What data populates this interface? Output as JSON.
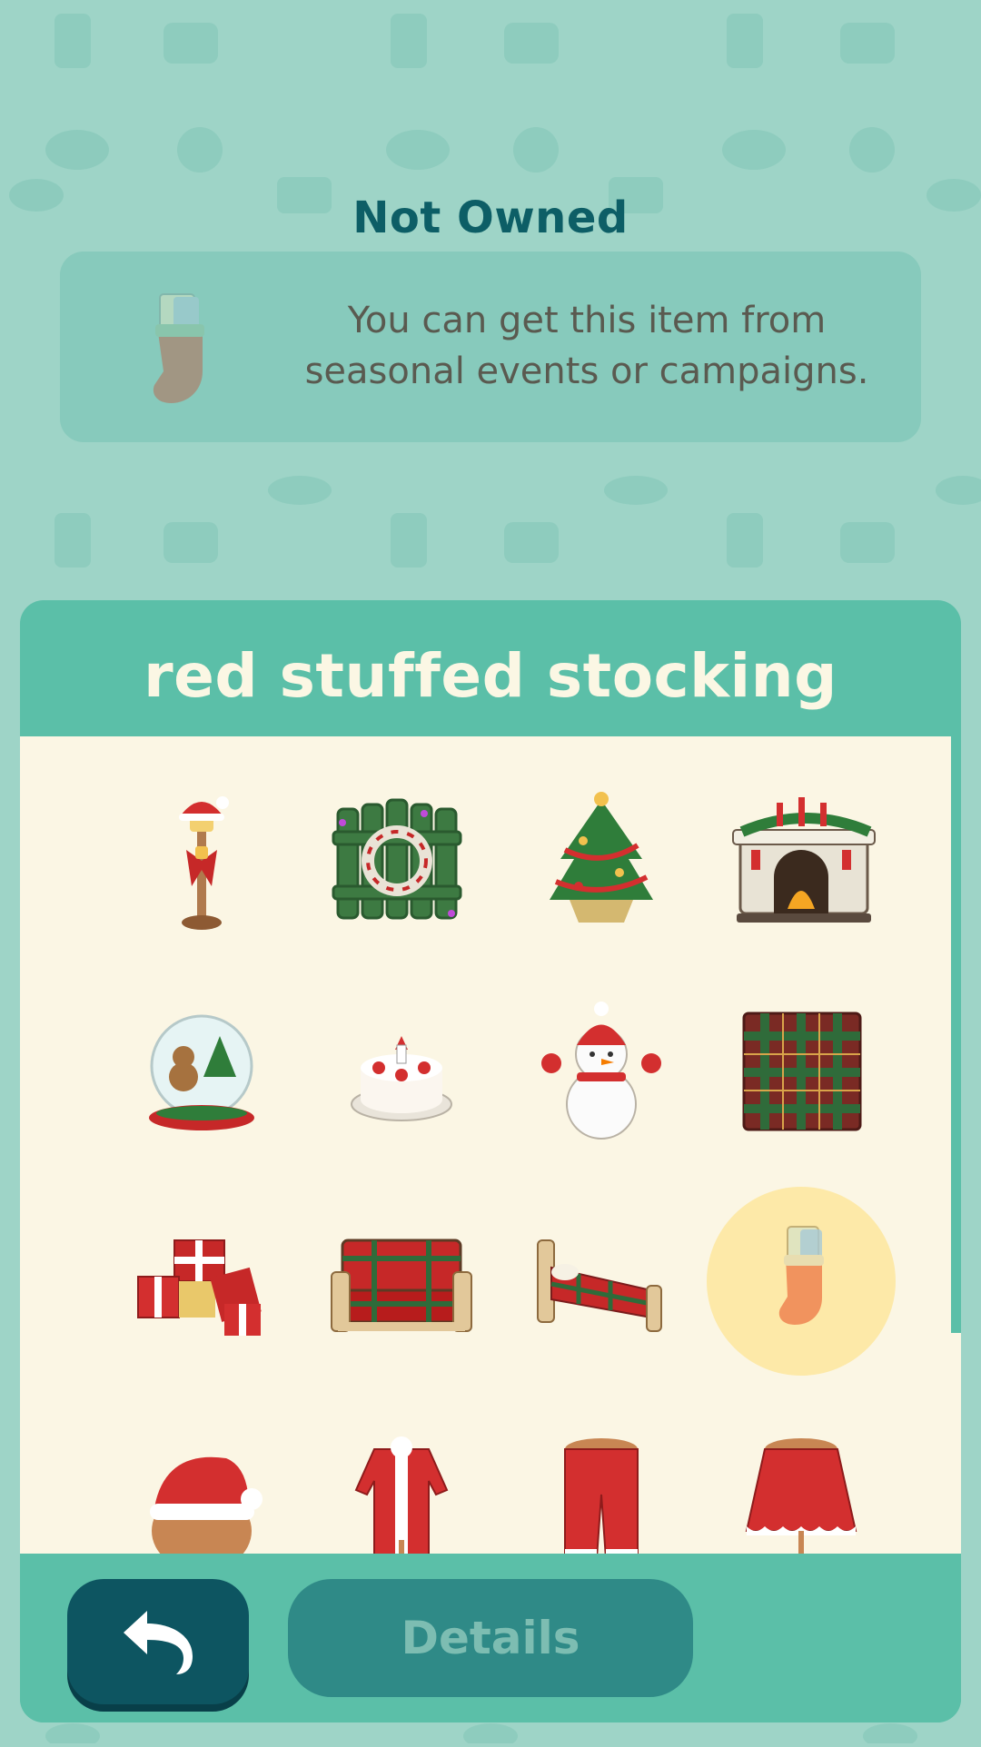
{
  "status": {
    "title": "Not Owned"
  },
  "info": {
    "text": "You can get this item from seasonal events or campaigns."
  },
  "panel": {
    "title": "red stuffed stocking"
  },
  "items": [
    {
      "name": "santa-lamp-icon"
    },
    {
      "name": "wreath-fence-icon"
    },
    {
      "name": "festive-tree-icon"
    },
    {
      "name": "festive-fireplace-icon"
    },
    {
      "name": "snow-globe-icon"
    },
    {
      "name": "holiday-cake-icon"
    },
    {
      "name": "snowman-icon"
    },
    {
      "name": "plaid-rug-icon"
    },
    {
      "name": "gift-pile-icon"
    },
    {
      "name": "plaid-sofa-icon"
    },
    {
      "name": "plaid-bed-icon"
    },
    {
      "name": "red-stocking-icon",
      "selected": true
    },
    {
      "name": "santa-hat-icon"
    },
    {
      "name": "santa-coat-icon"
    },
    {
      "name": "santa-pants-icon"
    },
    {
      "name": "santa-skirt-icon"
    }
  ],
  "footer": {
    "details_label": "Details"
  },
  "colors": {
    "accent": "#5bbfa8",
    "dark": "#0d5561",
    "selected": "#fde9a8",
    "grid_bg": "#fbf6e4"
  }
}
